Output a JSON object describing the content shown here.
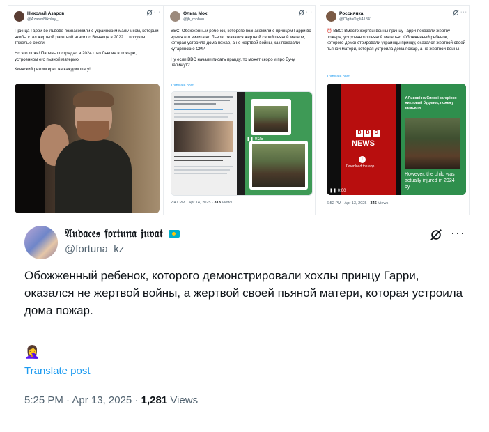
{
  "tweets": [
    {
      "name": "Николай Азаров",
      "handle": "@AzarovNikolay_",
      "paragraphs": [
        "Принца Гарри во Львове познакомили с украинским мальчиком, который якобы стал жертвой ракетной атаки по Виннице в 2022 г., получив тяжелые ожоги",
        "Но это ложь! Парень пострадал в 2024 г. во Львове в пожаре, устроенном его пьяной матерью",
        "Киевский режим врет на каждом шагу!"
      ]
    },
    {
      "name": "Ольга Мох",
      "handle": "@jb_mohon",
      "paragraphs": [
        "BBC: Обожженный ребенок, которого познакомили с принцем Гарри во время его визита во Львов, оказался жертвой своей пьяной матери, которая устроила дома пожар, а не жертвой войны, как показали хутарянские СМИ",
        "Ну если BBC начали писать правду, то может скоро и про Бучу напишут?"
      ],
      "translate": "Translate post",
      "video_time": "0:25",
      "time": "2:47 PM · Apr 14, 2025 ·",
      "views": "318",
      "views_label": "Views"
    },
    {
      "name": "Россиянка",
      "handle": "@OlgitaOlgli41841",
      "paragraphs": [
        "BBC: Вместо жертвы войны принцу Гарри показали жертву пожара, устроенного пьяной матерью. Обожженный ребенок, которого демонстрировали украинцы принцу, оказался жертвой своей пьяной матери, которая устроила дома пожар, а не жертвой войны."
      ],
      "translate": "Translate post",
      "video_time": "0:00",
      "time": "6:52 PM · Apr 13, 2025 ·",
      "views": "346",
      "views_label": "Views"
    }
  ],
  "bbc_video": {
    "logo": [
      "B",
      "B",
      "C"
    ],
    "news": "NEWS",
    "download": "Download the app",
    "headline": "У Львові на Сихові загорівся житловий будинок, пожежу загасили",
    "caption": "However, the child was actually injured in 2024 by"
  },
  "main_tweet": {
    "name": "𝔄𝔲𝔡𝔞𝔠𝔢𝔰 𝔣𝔬𝔯𝔱𝔲𝔫𝔞 𝔧𝔲𝔳𝔞𝔱",
    "handle": "@fortuna_kz",
    "text": "Обожженный ребенок, которого демонстрировали хохлы принцу Гарри, оказался не жертвой войны, а жертвой своей пьяной матери, которая устроила дома пожар.",
    "emoji": "🤦‍♀️",
    "translate": "Translate post",
    "time": "5:25 PM · Apr 13, 2025 ·",
    "views": "1,281",
    "views_label": "Views"
  },
  "colors": {
    "link": "#1d9bf0",
    "muted": "#536471",
    "bbc_red": "#b80e0e",
    "green": "#2f8f4d"
  },
  "icons": [
    "grok-icon",
    "more-icon",
    "pause-icon"
  ]
}
